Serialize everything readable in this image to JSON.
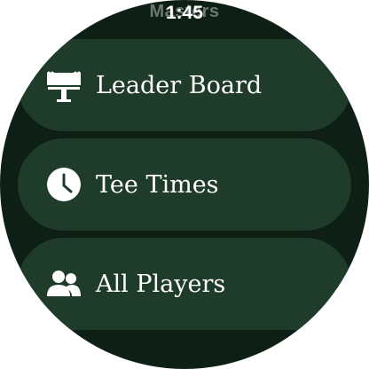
{
  "header": {
    "app_title": "Masters",
    "time": "1:45"
  },
  "menu": {
    "items": [
      {
        "label": "Leader Board",
        "icon": "leaderboard-sign-icon"
      },
      {
        "label": "Tee Times",
        "icon": "clock-icon"
      },
      {
        "label": "All Players",
        "icon": "players-group-icon"
      }
    ]
  },
  "colors": {
    "background": "#0e1f16",
    "item_background": "#1f3b2a",
    "text": "#ffffff"
  }
}
